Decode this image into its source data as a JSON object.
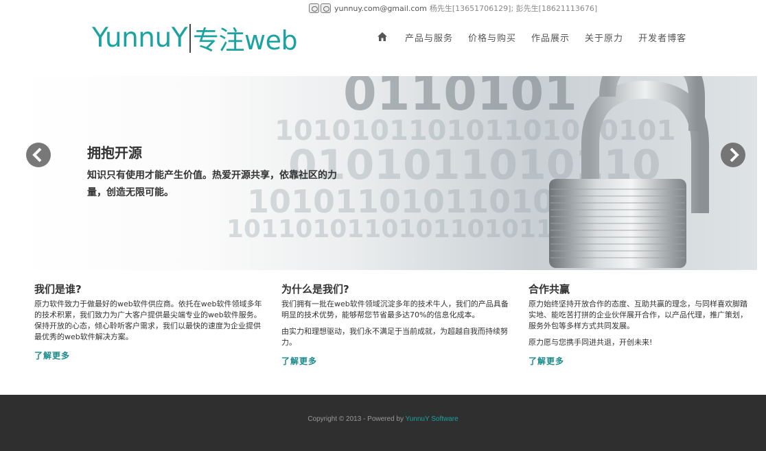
{
  "topbar": {
    "email": "yunnuy.com@gmail.com",
    "people": "杨先生[13651706129]; 彭先生[18621113676]"
  },
  "logo": {
    "brand": "YunnuY",
    "tagline": "专注web",
    "color": "#1aa3a0"
  },
  "nav": {
    "home_icon": "home-icon",
    "items": [
      "产品与服务",
      "价格与购买",
      "作品展示",
      "关于原力",
      "开发者博客"
    ]
  },
  "hero": {
    "title": "拥抱开源",
    "text": "知识只有使用才能产生价值。热爱开源共享，依靠社区的力量，创造无限可能。",
    "prev_icon": "chevron-left-icon",
    "next_icon": "chevron-right-icon"
  },
  "columns": [
    {
      "title": "我们是谁?",
      "paragraphs": [
        "原力软件致力于做最好的web软件供应商。依托在web软件领域多年的技术积累，我们致力为广大客户提供最尖端专业的web软件服务。保持开放的心态，倾心聆听客户需求，我们以最快的速度为企业提供最优秀的web软件解决方案。"
      ],
      "link": "了解更多"
    },
    {
      "title": "为什么是我们?",
      "paragraphs": [
        "我们拥有一批在web软件领域沉淀多年的技术牛人，我们的产品具备明显的技术优势，能够帮您节省最多达70%的信息化成本。",
        "由实力和理想驱动，我们永不满足于当前成就，为超越自我而持续努力。"
      ],
      "link": "了解更多"
    },
    {
      "title": "合作共赢",
      "paragraphs": [
        "原力始终坚持开放合作的态度、互助共赢的理念，与同样喜欢脚踏实地、能吃苦打拼的企业伙伴展开合作，以产品代理，推广策划，服务外包等多样方式共同发展。",
        "原力愿与您携手同进共退，开创未来!"
      ],
      "link": "了解更多"
    }
  ],
  "footer": {
    "copyright": "Copyright © 2013 - Powered by ",
    "brand": "YunnuY Software"
  }
}
